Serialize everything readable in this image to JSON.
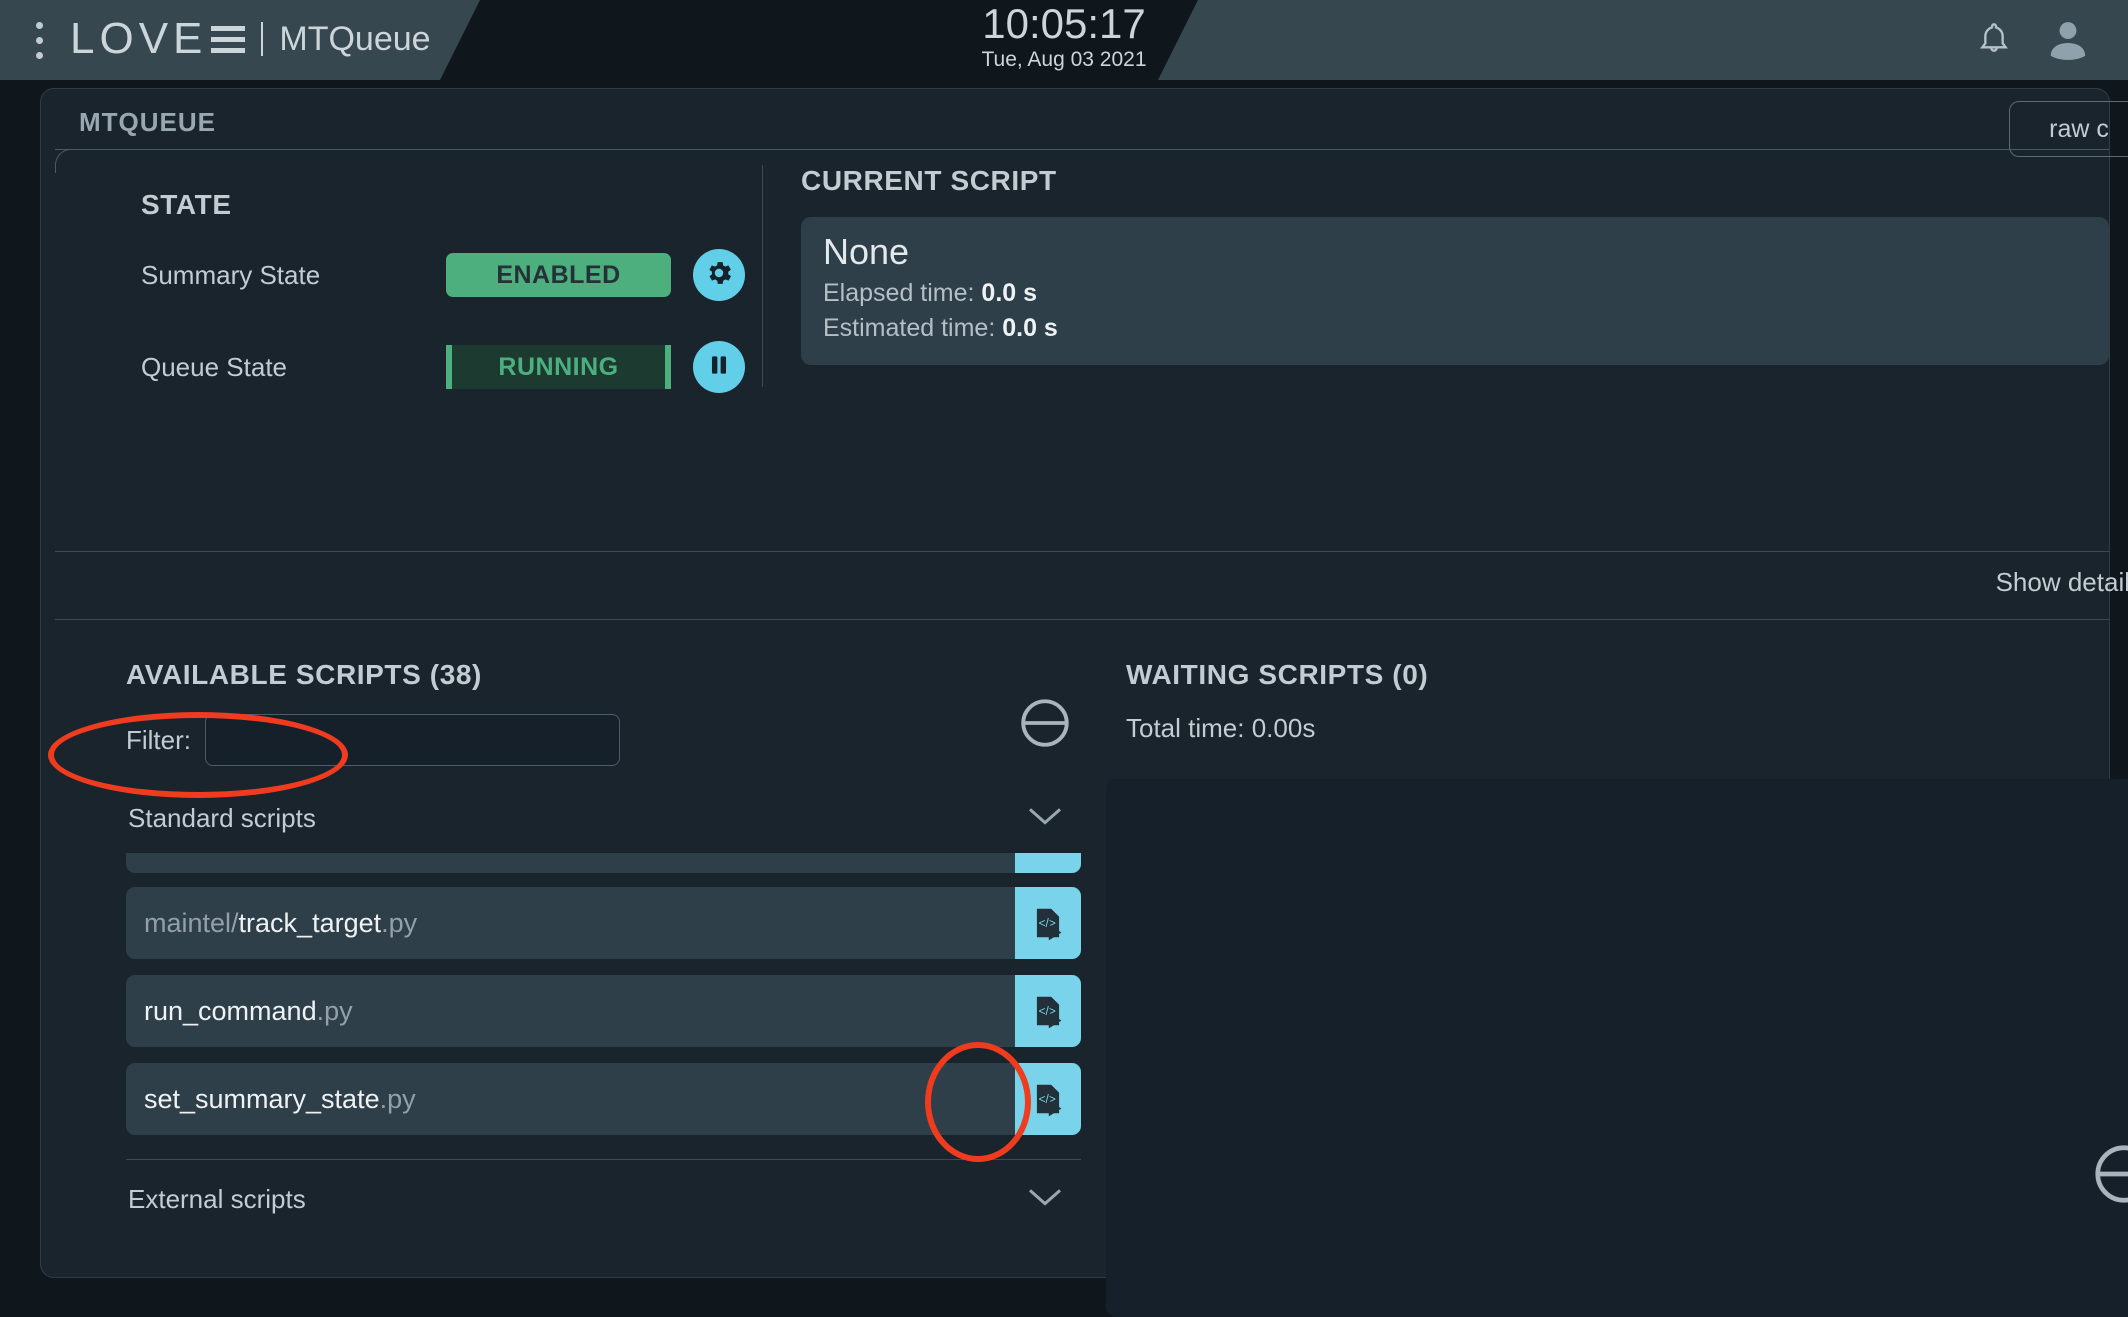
{
  "topbar": {
    "menu_icon": "kebab-menu-icon",
    "logo_text": "LOVE",
    "app_name": "MTQueue",
    "time": "10:05:17",
    "date": "Tue, Aug 03 2021",
    "bell_icon": "bell-icon",
    "user_icon": "user-avatar-icon"
  },
  "card": {
    "title": "MTQUEUE",
    "raw_button": "raw c",
    "show_details": "Show details"
  },
  "state": {
    "heading": "STATE",
    "summary_label": "Summary State",
    "summary_value": "ENABLED",
    "summary_color": "#4caf7d",
    "summary_action_icon": "gear-icon",
    "queue_label": "Queue State",
    "queue_value": "RUNNING",
    "queue_color": "#4caf7d",
    "queue_action_icon": "pause-icon"
  },
  "current_script": {
    "heading": "CURRENT SCRIPT",
    "name": "None",
    "elapsed_label": "Elapsed time:",
    "elapsed_value": "0.0 s",
    "estimated_label": "Estimated time:",
    "estimated_value": "0.0 s"
  },
  "available": {
    "heading": "AVAILABLE SCRIPTS (38)",
    "filter_label": "Filter:",
    "filter_value": "",
    "filter_placeholder": "",
    "stop_icon": "stop-circle-icon",
    "groups": [
      {
        "title": "Standard scripts",
        "chevron": "chevron-down-icon",
        "expanded": true,
        "scripts": [
          {
            "path": "",
            "name": "",
            "ext": "",
            "clipped": true,
            "launch_icon": "run-script-icon"
          },
          {
            "path": "maintel/",
            "name": "track_target",
            "ext": ".py",
            "clipped": false,
            "launch_icon": "run-script-icon"
          },
          {
            "path": "",
            "name": "run_command",
            "ext": ".py",
            "clipped": false,
            "launch_icon": "run-script-icon"
          },
          {
            "path": "",
            "name": "set_summary_state",
            "ext": ".py",
            "clipped": false,
            "launch_icon": "run-script-icon"
          }
        ]
      },
      {
        "title": "External scripts",
        "chevron": "chevron-down-icon",
        "expanded": false,
        "scripts": []
      }
    ]
  },
  "waiting": {
    "heading": "WAITING SCRIPTS (0)",
    "total_label": "Total time: 0.00s"
  },
  "annotations": {
    "color": "#ef3b1e",
    "items": [
      {
        "name": "annotation-standard-scripts-group"
      },
      {
        "name": "annotation-launch-script-button"
      }
    ]
  }
}
